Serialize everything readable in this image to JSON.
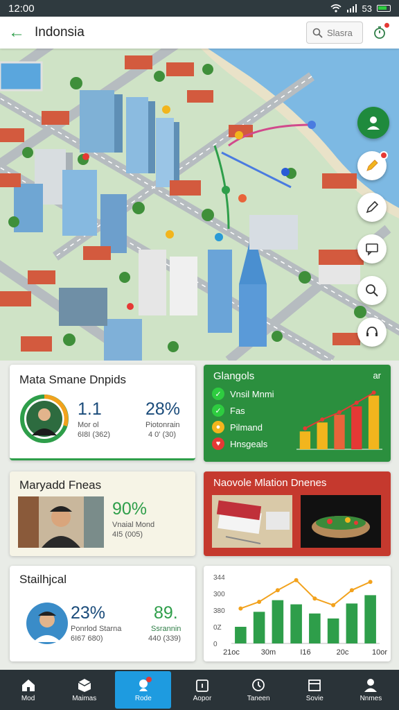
{
  "status": {
    "time": "12:00",
    "battery_text": "53"
  },
  "appbar": {
    "title": "Indonsia",
    "search_placeholder": "Slasra"
  },
  "cards": {
    "matrix": {
      "title": "Mata Smane Dnpids",
      "stat1_value": "1.1",
      "stat1_label": "Mor ol",
      "stat1_sub": "6I8I (362)",
      "stat2_value": "28%",
      "stat2_label": "Piotonrain",
      "stat2_sub": "4 0' (30)"
    },
    "legend": {
      "title": "Glangols",
      "corner": "ar",
      "items": [
        {
          "label": "Vnsil Mnmi",
          "color": "#2ecc40",
          "icon": "leaf-icon"
        },
        {
          "label": "Fas",
          "color": "#2ecc40",
          "icon": "leaf-icon"
        },
        {
          "label": "Pilmand",
          "color": "#f2b51d",
          "icon": "pin-icon"
        },
        {
          "label": "Hnsgeals",
          "color": "#e53935",
          "icon": "heart-icon"
        }
      ]
    },
    "marketplace": {
      "title": "Maryadd Fneas",
      "value": "90%",
      "label": "Vnaial Mond",
      "sub": "4I5 (005)"
    },
    "nation": {
      "title": "Naovole Mlation Dnenes"
    },
    "statistical": {
      "title": "Stailhjcal",
      "stat1_value": "23%",
      "stat1_label": "Ponrlod Starna",
      "stat1_sub": "6I67 680)",
      "stat2_value": "89.",
      "stat2_label": "Ssrannin",
      "stat2_sub": "440 (339)"
    }
  },
  "chart_data": [
    {
      "type": "bar",
      "values": [
        0.3,
        0.45,
        0.58,
        0.72,
        0.9
      ],
      "colors": [
        "#f2b51d",
        "#f2b51d",
        "#e8643a",
        "#e53935",
        "#f2b51d"
      ],
      "trend": [
        0.35,
        0.5,
        0.62,
        0.78,
        0.95
      ]
    },
    {
      "type": "bar",
      "categories": [
        "21oc",
        "30m",
        "I16",
        "20c",
        "10or"
      ],
      "y_ticks": [
        "344",
        "300",
        "380",
        "0Z",
        "0"
      ],
      "values": [
        100,
        190,
        260,
        235,
        180,
        150,
        240,
        290
      ],
      "line": [
        210,
        250,
        320,
        380,
        270,
        230,
        320,
        370
      ],
      "ylim": [
        0,
        400
      ]
    }
  ],
  "nav": [
    {
      "label": "Mod",
      "icon": "home-icon"
    },
    {
      "label": "Maimas",
      "icon": "box-icon"
    },
    {
      "label": "Rode",
      "icon": "route-icon",
      "active": true
    },
    {
      "label": "Aopor",
      "icon": "calendar-icon"
    },
    {
      "label": "Taneen",
      "icon": "clock-icon"
    },
    {
      "label": "Sovie",
      "icon": "store-icon"
    },
    {
      "label": "Nnmes",
      "icon": "person-icon"
    }
  ]
}
